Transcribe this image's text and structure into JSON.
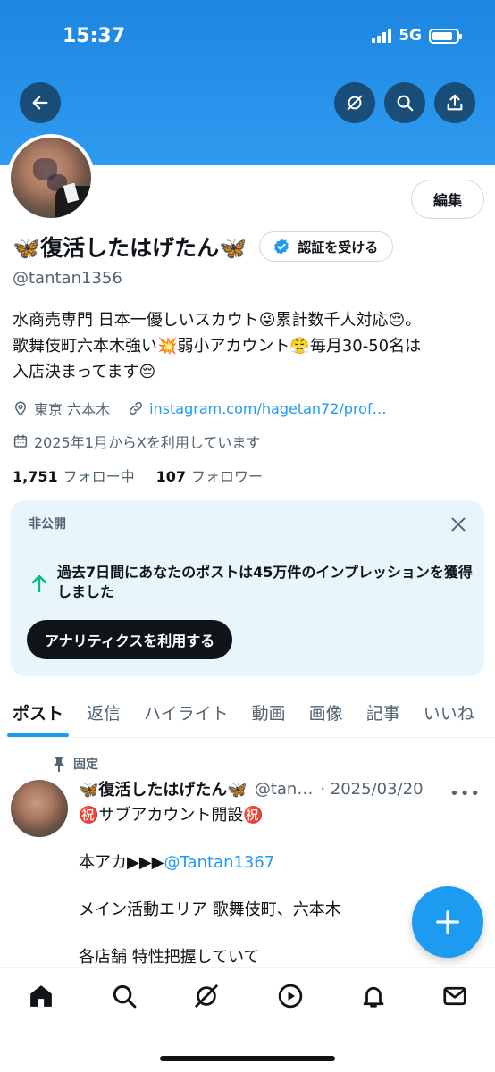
{
  "status_bar": {
    "time": "15:37",
    "network": "5G",
    "battery_level": 0.85
  },
  "header": {
    "back_icon": "arrow-left-icon",
    "grok_icon": "grok-icon",
    "search_icon": "search-icon",
    "share_icon": "share-icon",
    "banner_color": "#1d9bf0"
  },
  "profile": {
    "edit_label": "編集",
    "display_name": "🦋復活したはげたん🦋",
    "verify_label": "認証を受ける",
    "handle": "@tantan1356",
    "bio_lines": [
      "水商売専門 日本一優しいスカウト😜累計数千人対応😔。",
      "歌舞伎町六本木強い💥弱小アカウント😤毎月30-50名は",
      "入店決まってます😔"
    ],
    "location": "東京 六本木",
    "website": "instagram.com/hagetan72/prof…",
    "joined": "2025年1月からXを利用しています",
    "following_count": "1,751",
    "following_label": "フォロー中",
    "followers_count": "107",
    "followers_label": "フォロワー"
  },
  "analytics_card": {
    "label": "非公開",
    "text": "過去7日間にあなたのポストは45万件のインプレッションを獲得しました",
    "button_label": "アナリティクスを利用する",
    "accent_color": "#00ba7c"
  },
  "tabs": [
    {
      "label": "ポスト",
      "active": true
    },
    {
      "label": "返信",
      "active": false
    },
    {
      "label": "ハイライト",
      "active": false
    },
    {
      "label": "動画",
      "active": false
    },
    {
      "label": "画像",
      "active": false
    },
    {
      "label": "記事",
      "active": false
    },
    {
      "label": "いいね",
      "active": false
    }
  ],
  "post": {
    "pinned_label": "固定",
    "name": "🦋復活したはげたん🦋",
    "handle": "@tan…",
    "date": "· 2025/03/20",
    "more": "•••",
    "lines": [
      "㊗️サブアカウント開設㊗️",
      "本アカ▶▶▶",
      "@Tantan1367",
      "メイン活動エリア 歌舞伎町、六本木",
      "各店舗 特性把握していて"
    ]
  },
  "fab": {
    "icon": "plus-icon"
  },
  "bottom_nav": [
    "home-icon",
    "search-icon",
    "grok-icon",
    "video-icon",
    "notifications-icon",
    "messages-icon"
  ]
}
